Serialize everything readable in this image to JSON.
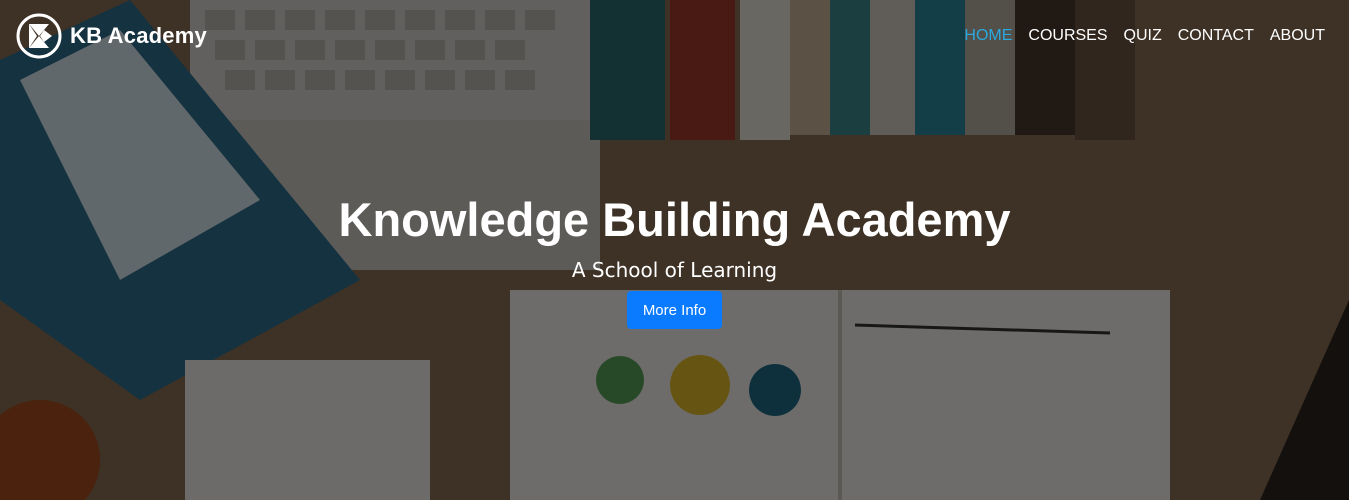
{
  "brand": {
    "name": "KB Academy",
    "logo_icon": "kb-academy-logo-icon"
  },
  "nav": [
    {
      "label": "HOME",
      "active": true
    },
    {
      "label": "COURSES",
      "active": false
    },
    {
      "label": "QUIZ",
      "active": false
    },
    {
      "label": "CONTACT",
      "active": false
    },
    {
      "label": "ABOUT",
      "active": false
    }
  ],
  "hero": {
    "title": "Knowledge Building Academy",
    "subtitle": "A School of Learning",
    "button_label": "More Info"
  },
  "colors": {
    "active_nav": "#2aa8e0",
    "button": "#0a7bff"
  }
}
